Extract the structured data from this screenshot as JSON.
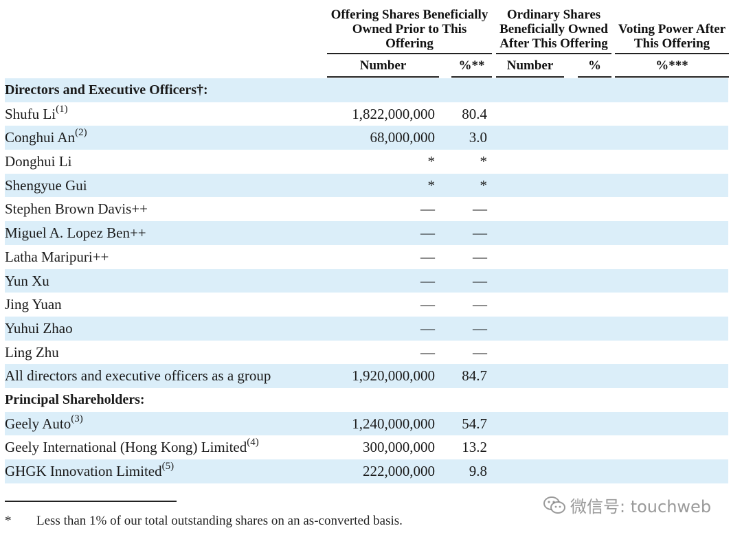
{
  "header": {
    "group1": [
      "Offering Shares Beneficially",
      "Owned Prior to This",
      "Offering"
    ],
    "group2": [
      "Ordinary Shares",
      "Beneficially Owned",
      "After This Offering"
    ],
    "group3": [
      "Voting Power After",
      "This Offering"
    ],
    "sub_number_1": "Number",
    "sub_pct_1": "%**",
    "sub_number_2": "Number",
    "sub_pct_2": "%",
    "sub_pct_3": "%***"
  },
  "rows": [
    {
      "name": "Directors and Executive Officers†:",
      "sup": "",
      "number": "",
      "pct": "",
      "section": true
    },
    {
      "name": "Shufu Li",
      "sup": "(1)",
      "number": "1,822,000,000",
      "pct": "80.4"
    },
    {
      "name": "Conghui An",
      "sup": "(2)",
      "number": "68,000,000",
      "pct": "3.0"
    },
    {
      "name": "Donghui Li",
      "sup": "",
      "number": "*",
      "pct": "*"
    },
    {
      "name": "Shengyue Gui",
      "sup": "",
      "number": "*",
      "pct": "*"
    },
    {
      "name": "Stephen Brown Davis++",
      "sup": "",
      "number": "—",
      "pct": "—"
    },
    {
      "name": "Miguel A. Lopez Ben++",
      "sup": "",
      "number": "—",
      "pct": "—"
    },
    {
      "name": "Latha Maripuri++",
      "sup": "",
      "number": "—",
      "pct": "—"
    },
    {
      "name": "Yun Xu",
      "sup": "",
      "number": "—",
      "pct": "—"
    },
    {
      "name": "Jing Yuan",
      "sup": "",
      "number": "—",
      "pct": "—"
    },
    {
      "name": "Yuhui Zhao",
      "sup": "",
      "number": "—",
      "pct": "—"
    },
    {
      "name": "Ling Zhu",
      "sup": "",
      "number": "—",
      "pct": "—"
    },
    {
      "name": "All directors and executive officers as a group",
      "sup": "",
      "number": "1,920,000,000",
      "pct": "84.7"
    },
    {
      "name": "Principal Shareholders:",
      "sup": "",
      "number": "",
      "pct": "",
      "section": true
    },
    {
      "name": "Geely Auto",
      "sup": "(3)",
      "number": "1,240,000,000",
      "pct": "54.7"
    },
    {
      "name": "Geely International (Hong Kong) Limited",
      "sup": "(4)",
      "number": "300,000,000",
      "pct": "13.2"
    },
    {
      "name": "GHGK Innovation Limited",
      "sup": "(5)",
      "number": "222,000,000",
      "pct": "9.8"
    }
  ],
  "footnote": {
    "mark": "*",
    "text": "Less than 1% of our total outstanding shares on an as-converted basis."
  },
  "watermark": {
    "text": "微信号: touchweb",
    "icon": "wechat-icon"
  },
  "colors": {
    "row_shade": "#dbeef9",
    "text": "#1a1a1a"
  }
}
